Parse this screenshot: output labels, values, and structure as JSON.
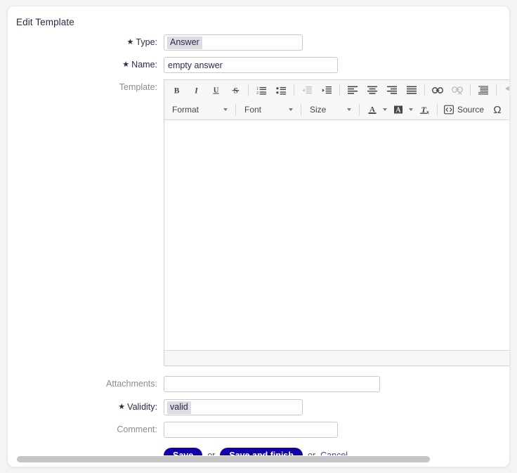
{
  "panel": {
    "title": "Edit Template"
  },
  "form": {
    "type": {
      "label": "Type:",
      "required": true,
      "value": "Answer"
    },
    "name": {
      "label": "Name:",
      "required": true,
      "value": "empty answer",
      "placeholder": ""
    },
    "template": {
      "label": "Template:",
      "required": false,
      "value": ""
    },
    "attachments": {
      "label": "Attachments:",
      "required": false,
      "value": "",
      "placeholder": ""
    },
    "validity": {
      "label": "Validity:",
      "required": true,
      "value": "valid"
    },
    "comment": {
      "label": "Comment:",
      "required": false,
      "value": "",
      "placeholder": ""
    }
  },
  "editor": {
    "toolbar_row1": [
      {
        "name": "bold",
        "icon": "bold",
        "label": "B",
        "disabled": false
      },
      {
        "name": "italic",
        "icon": "italic",
        "label": "I",
        "disabled": false
      },
      {
        "name": "underline",
        "icon": "underline",
        "label": "U",
        "disabled": false
      },
      {
        "name": "strikethrough",
        "icon": "strikethrough",
        "label": "S",
        "disabled": false
      },
      {
        "name": "numbered-list",
        "icon": "numbered-list",
        "label": "",
        "disabled": false
      },
      {
        "name": "bulleted-list",
        "icon": "bulleted-list",
        "label": "",
        "disabled": false
      },
      {
        "name": "decrease-indent",
        "icon": "decrease-indent",
        "label": "",
        "disabled": true
      },
      {
        "name": "increase-indent",
        "icon": "increase-indent",
        "label": "",
        "disabled": false
      },
      {
        "name": "align-left",
        "icon": "align-left",
        "label": "",
        "disabled": false
      },
      {
        "name": "align-center",
        "icon": "align-center",
        "label": "",
        "disabled": false
      },
      {
        "name": "align-right",
        "icon": "align-right",
        "label": "",
        "disabled": false
      },
      {
        "name": "align-justify",
        "icon": "align-justify",
        "label": "",
        "disabled": false
      },
      {
        "name": "link",
        "icon": "link",
        "label": "",
        "disabled": false
      },
      {
        "name": "unlink",
        "icon": "unlink",
        "label": "",
        "disabled": true
      },
      {
        "name": "blockquote",
        "icon": "blockquote",
        "label": "",
        "disabled": false
      },
      {
        "name": "undo",
        "icon": "undo",
        "label": "",
        "disabled": true
      }
    ],
    "toolbar_row2": {
      "format_label": "Format",
      "font_label": "Font",
      "size_label": "Size",
      "text_color_label": "A",
      "bg_color_label": "A",
      "remove_format_label": "Tx",
      "source_label": "Source",
      "special_char_label": "Ω"
    },
    "content": ""
  },
  "actions": {
    "save_label": "Save",
    "or_label_1": "or",
    "save_and_finish_label": "Save and finish",
    "or_label_2": "or",
    "cancel_label": "Cancel"
  },
  "colors": {
    "accent": "#1300a8",
    "link": "#2b3df0",
    "label": "#8a8a96",
    "label_required": "#2a2a4a",
    "page_bg": "#f4f4f6",
    "toolbar_bg": "#f7f7f7"
  }
}
